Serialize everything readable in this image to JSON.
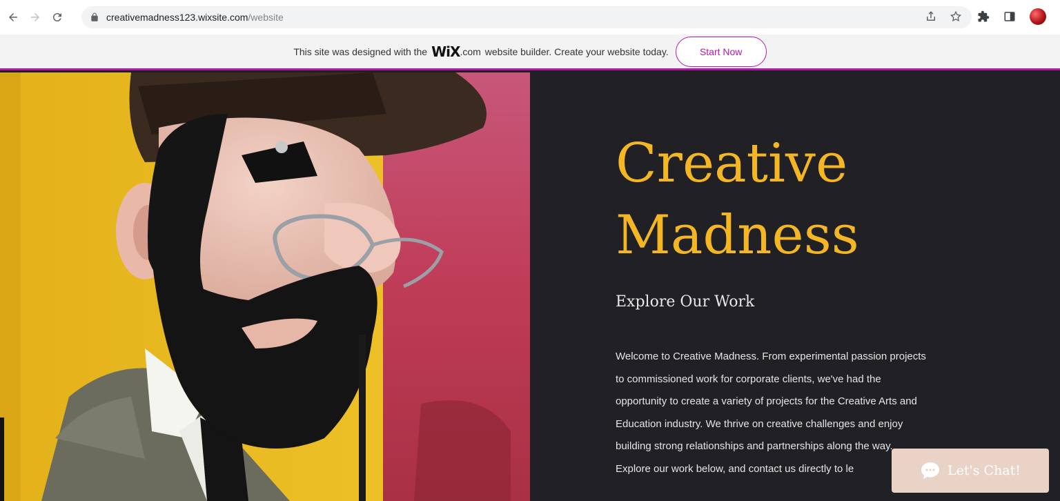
{
  "browser": {
    "url_host": "creativemadness123.wixsite.com",
    "url_path": "/website",
    "icons": [
      "back-arrow-icon",
      "forward-arrow-icon",
      "reload-icon",
      "lock-icon",
      "share-icon",
      "star-icon",
      "extensions-icon",
      "side-panel-icon",
      "profile-avatar"
    ]
  },
  "wix_banner": {
    "text_before": "This site was designed with the",
    "logo": "WiX",
    "logo_domain": ".com",
    "text_after": "website builder. Create your website today.",
    "button_label": "Start Now",
    "accent_color": "#b516a8"
  },
  "hero": {
    "title_line1": "Creative",
    "title_line2": "Madness",
    "subtitle": "Explore Our Work",
    "body_lines": [
      "Welcome to Creative Madness. From experimental passion projects",
      "to commissioned work for corporate clients, we've had the",
      "opportunity to create a variety of projects for the Creative Arts and",
      "Education industry. We thrive on creative challenges and enjoy",
      "building strong relationships and partnerships along the way.",
      "Explore our work below, and contact us directly to le"
    ],
    "title_color": "#f4b624",
    "background_color": "#202025"
  },
  "chat": {
    "label": "Let's Chat!",
    "background_color": "#e9d3c7"
  }
}
